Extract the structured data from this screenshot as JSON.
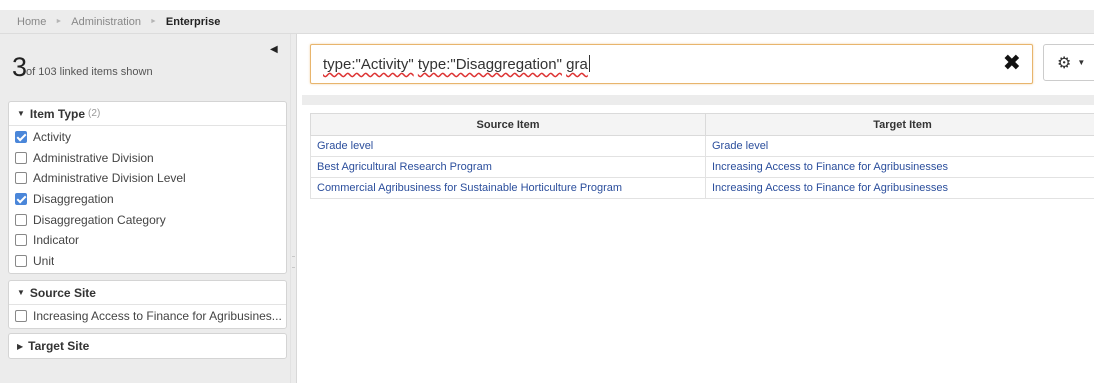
{
  "breadcrumb": {
    "items": [
      "Home",
      "Administration"
    ],
    "current": "Enterprise"
  },
  "summary": {
    "count": "3",
    "text": "of 103 linked items shown",
    "collapse_icon": "caret-left-icon"
  },
  "filters": {
    "item_type": {
      "title": "Item Type",
      "badge": "(2)",
      "options": [
        {
          "label": "Activity",
          "checked": true
        },
        {
          "label": "Administrative Division",
          "checked": false
        },
        {
          "label": "Administrative Division Level",
          "checked": false
        },
        {
          "label": "Disaggregation",
          "checked": true
        },
        {
          "label": "Disaggregation Category",
          "checked": false
        },
        {
          "label": "Indicator",
          "checked": false
        },
        {
          "label": "Unit",
          "checked": false
        }
      ]
    },
    "source_site": {
      "title": "Source Site",
      "options": [
        {
          "label": "Increasing Access to Finance for Agribusines...",
          "checked": false
        }
      ]
    },
    "target_site": {
      "title": "Target Site"
    }
  },
  "search": {
    "q1": "type:\"Activity\"",
    "q2": "type:\"Disaggregation\"",
    "q3": "gra",
    "clear_icon": "close-icon"
  },
  "toolbar": {
    "settings_icon": "gear-icon"
  },
  "table": {
    "headers": [
      "Source Item",
      "Target Item"
    ],
    "rows": [
      [
        "Grade level",
        "Grade level"
      ],
      [
        "Best Agricultural Research Program",
        "Increasing Access to Finance for Agribusinesses"
      ],
      [
        "Commercial Agribusiness for Sustainable Horticulture Program",
        "Increasing Access to Finance for Agribusinesses"
      ]
    ]
  },
  "colors": {
    "accent": "#4a86d9",
    "link": "#2b4e9c",
    "focus_border": "#e8b56d"
  }
}
